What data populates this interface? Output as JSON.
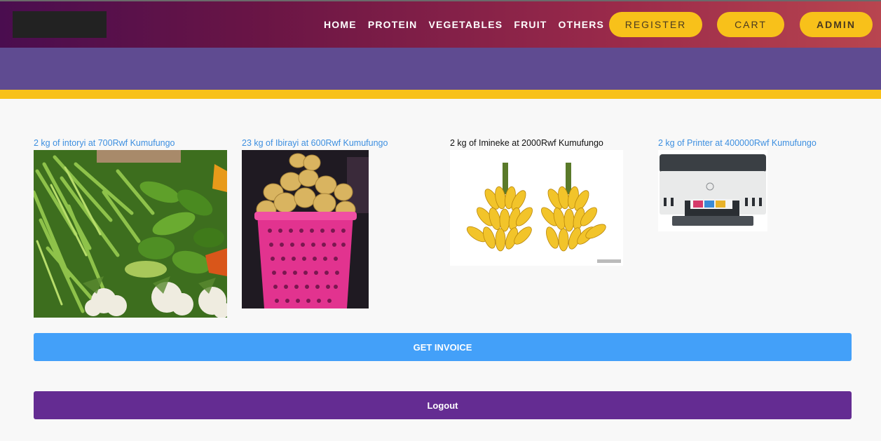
{
  "nav": {
    "links": [
      "HOME",
      "PROTEIN",
      "VEGETABLES",
      "FRUIT",
      "OTHERS"
    ],
    "register_label": "REGISTER",
    "cart_label": "CART",
    "admin_label": "ADMIN"
  },
  "products": [
    {
      "title": "2 kg of intoryi at 700Rwf Kumufungo",
      "image": "vegetables-photo"
    },
    {
      "title": "23 kg of Ibirayi at 600Rwf Kumufungo",
      "image": "potatoes-basket-photo"
    },
    {
      "title": "2 kg of Imineke at 2000Rwf Kumufungo",
      "image": "bananas-photo"
    },
    {
      "title": "2 kg of Printer at 400000Rwf Kumufungo",
      "image": "printer-photo"
    }
  ],
  "actions": {
    "invoice_label": "GET INVOICE",
    "logout_label": "Logout"
  },
  "colors": {
    "accent_yellow": "#f8c11a",
    "band_purple": "#5f4b91",
    "invoice_blue": "#43a0f9",
    "logout_purple": "#642c92"
  }
}
